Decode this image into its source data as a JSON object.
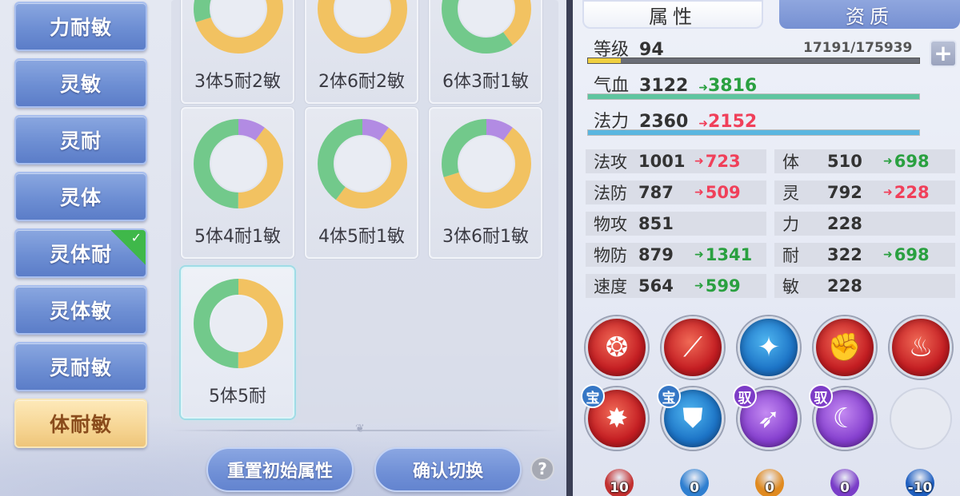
{
  "sidebar": {
    "items": [
      {
        "label": "力耐敏",
        "selected": false,
        "checked": false
      },
      {
        "label": "灵敏",
        "selected": false,
        "checked": false
      },
      {
        "label": "灵耐",
        "selected": false,
        "checked": false
      },
      {
        "label": "灵体",
        "selected": false,
        "checked": false
      },
      {
        "label": "灵体耐",
        "selected": false,
        "checked": true
      },
      {
        "label": "灵体敏",
        "selected": false,
        "checked": false
      },
      {
        "label": "灵耐敏",
        "selected": false,
        "checked": false
      },
      {
        "label": "体耐敏",
        "selected": true,
        "checked": false
      }
    ]
  },
  "colors": {
    "green": "#72c98b",
    "yellow": "#f2c261",
    "purple": "#b28be3"
  },
  "schemes": [
    {
      "label": "3体5耐2敏",
      "segments": {
        "green": 3,
        "yellow": 5,
        "purple": 2
      }
    },
    {
      "label": "2体6耐2敏",
      "segments": {
        "green": 2,
        "yellow": 6,
        "purple": 2
      }
    },
    {
      "label": "6体3耐1敏",
      "segments": {
        "green": 6,
        "yellow": 3,
        "purple": 1
      }
    },
    {
      "label": "5体4耐1敏",
      "segments": {
        "green": 5,
        "yellow": 4,
        "purple": 1
      }
    },
    {
      "label": "4体5耐1敏",
      "segments": {
        "green": 4,
        "yellow": 5,
        "purple": 1
      }
    },
    {
      "label": "3体6耐1敏",
      "segments": {
        "green": 3,
        "yellow": 6,
        "purple": 1
      }
    },
    {
      "label": "5体5耐",
      "segments": {
        "green": 5,
        "yellow": 5,
        "purple": 0
      },
      "selected": true
    }
  ],
  "actions": {
    "reset_label": "重置初始属性",
    "confirm_label": "确认切换",
    "help_label": "?"
  },
  "tabs": {
    "attributes": "属性",
    "aptitude": "资质"
  },
  "level": {
    "label": "等级",
    "value": "94",
    "exp": "17191/175939",
    "exp_fraction": 0.098
  },
  "hp": {
    "label": "气血",
    "value": "3122",
    "new_value": "3816",
    "direction": "up",
    "fill": 1.0,
    "color": "#5fc5a0"
  },
  "mp": {
    "label": "法力",
    "value": "2360",
    "new_value": "2152",
    "direction": "down",
    "fill": 1.0,
    "color": "#5ab6e0"
  },
  "plus_label": "+",
  "stats_left": [
    {
      "label": "法攻",
      "value": "1001",
      "new_value": "723",
      "direction": "down"
    },
    {
      "label": "法防",
      "value": "787",
      "new_value": "509",
      "direction": "down"
    },
    {
      "label": "物攻",
      "value": "851",
      "new_value": "",
      "direction": ""
    },
    {
      "label": "物防",
      "value": "879",
      "new_value": "1341",
      "direction": "up"
    },
    {
      "label": "速度",
      "value": "564",
      "new_value": "599",
      "direction": "up"
    }
  ],
  "stats_right": [
    {
      "label": "体",
      "value": "510",
      "new_value": "698",
      "direction": "up"
    },
    {
      "label": "灵",
      "value": "792",
      "new_value": "228",
      "direction": "down"
    },
    {
      "label": "力",
      "value": "228",
      "new_value": "",
      "direction": ""
    },
    {
      "label": "耐",
      "value": "322",
      "new_value": "698",
      "direction": "up"
    },
    {
      "label": "敏",
      "value": "228",
      "new_value": "",
      "direction": ""
    }
  ],
  "skills": [
    {
      "icon": "fire-swirl-icon",
      "color": "red",
      "tag": ""
    },
    {
      "icon": "slash-icon",
      "color": "red",
      "tag": ""
    },
    {
      "icon": "wind-blade-icon",
      "color": "blue",
      "tag": ""
    },
    {
      "icon": "fist-icon",
      "color": "red",
      "tag": ""
    },
    {
      "icon": "flame-icon",
      "color": "red",
      "tag": ""
    },
    {
      "icon": "explosion-icon",
      "color": "red",
      "tag": "宝"
    },
    {
      "icon": "shield-icon",
      "color": "blue",
      "tag": "宝"
    },
    {
      "icon": "kick-icon",
      "color": "purple",
      "tag": "驭"
    },
    {
      "icon": "claw-icon",
      "color": "purple",
      "tag": "驭"
    },
    {
      "icon": "empty-slot",
      "color": "empty",
      "tag": ""
    }
  ],
  "elements": [
    {
      "value": "10",
      "color": "#c23030",
      "icon": "fire-element-icon"
    },
    {
      "value": "0",
      "color": "#2f7fd0",
      "icon": "water-element-icon"
    },
    {
      "value": "0",
      "color": "#e08a20",
      "icon": "earth-element-icon"
    },
    {
      "value": "0",
      "color": "#7a3ec8",
      "icon": "dark-element-icon"
    },
    {
      "value": "-10",
      "color": "#1f5fc0",
      "icon": "ice-element-icon"
    }
  ]
}
